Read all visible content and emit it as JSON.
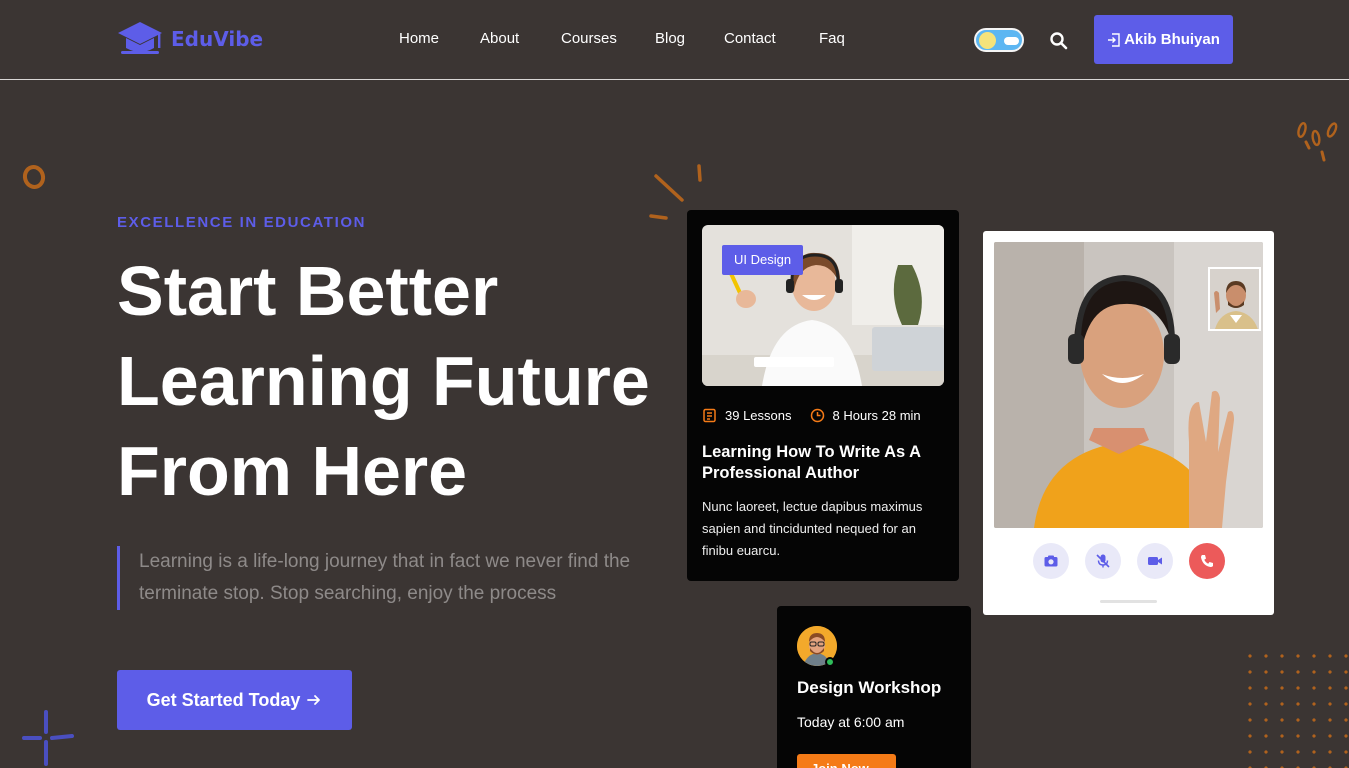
{
  "brand": {
    "name": "EduVibe",
    "logo_icon": "graduation-cap-icon",
    "accent": "#5d5de8"
  },
  "nav": {
    "items": [
      {
        "label": "Home"
      },
      {
        "label": "About"
      },
      {
        "label": "Courses"
      },
      {
        "label": "Blog"
      },
      {
        "label": "Contact"
      },
      {
        "label": "Faq"
      }
    ]
  },
  "header": {
    "theme_toggle_icon": "sun-cloud-icon",
    "search_icon": "search-icon",
    "login_icon": "sign-in-icon",
    "user_label": "Akib Bhuiyan"
  },
  "hero": {
    "eyebrow": "EXCELLENCE IN EDUCATION",
    "title_line1": "Start Better",
    "title_line2": "Learning Future",
    "title_line3": "From Here",
    "description": "Learning is a life-long journey that in fact we never find the terminate stop. Stop searching, enjoy the process",
    "cta_label": "Get Started Today",
    "cta_icon": "arrow-right-icon"
  },
  "course_card": {
    "tag": "UI Design",
    "lessons": "39 Lessons",
    "duration": "8 Hours 28 min",
    "title": "Learning How To Write As A Professional Author",
    "description": "Nunc laoreet, lectue dapibus maximus sapien and tincidunted nequed for an finibu euarcu."
  },
  "video_card": {
    "controls": [
      "camera-icon",
      "mic-off-icon",
      "video-icon",
      "phone-end-icon"
    ],
    "end_call_color": "#ec5a5a"
  },
  "workshop_card": {
    "title": "Design Workshop",
    "time": "Today at 6:00 am",
    "button_label": "Join Now",
    "button_color": "#f57b17"
  }
}
